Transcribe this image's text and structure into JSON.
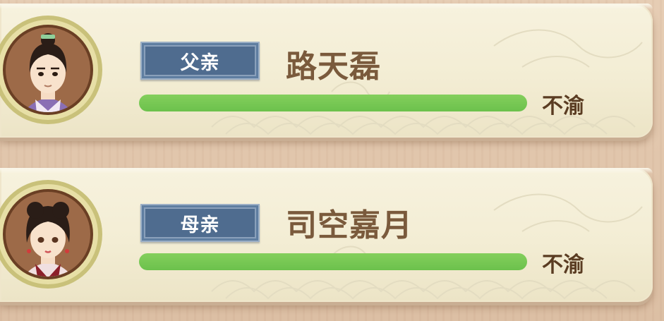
{
  "relatives": [
    {
      "role": "父亲",
      "name": "路天磊",
      "mood": "不渝",
      "relation_level": 1.0,
      "portrait": "father-portrait-icon"
    },
    {
      "role": "母亲",
      "name": "司空嘉月",
      "mood": "不渝",
      "relation_level": 1.0,
      "portrait": "mother-portrait-icon"
    }
  ],
  "colors": {
    "badge": "#4f6c8f",
    "bar": "#78c856",
    "name_text": "#7a5a3c",
    "mood_text": "#5a3c22",
    "paper": "#f5f0da",
    "frame": "#c9c17a"
  }
}
